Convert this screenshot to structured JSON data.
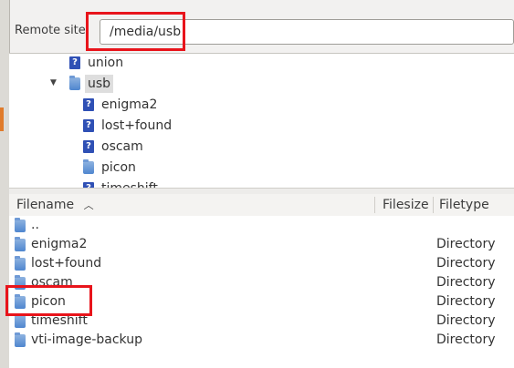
{
  "remote": {
    "label": "Remote site:",
    "path": "/media/usb"
  },
  "tree": {
    "items": [
      {
        "label": "union",
        "icon": "question-icon"
      },
      {
        "label": "usb",
        "icon": "folder-icon",
        "expanded": true,
        "selected": true
      },
      {
        "label": "enigma2",
        "icon": "question-icon"
      },
      {
        "label": "lost+found",
        "icon": "question-icon"
      },
      {
        "label": "oscam",
        "icon": "question-icon"
      },
      {
        "label": "picon",
        "icon": "folder-icon"
      },
      {
        "label": "timeshift",
        "icon": "question-icon"
      }
    ]
  },
  "filelist": {
    "columns": {
      "filename": "Filename",
      "filesize": "Filesize",
      "filetype": "Filetype",
      "sort_icon": "sort-ascending-icon"
    },
    "rows": [
      {
        "name": "..",
        "type": ""
      },
      {
        "name": "enigma2",
        "type": "Directory"
      },
      {
        "name": "lost+found",
        "type": "Directory"
      },
      {
        "name": "oscam",
        "type": "Directory"
      },
      {
        "name": "picon",
        "type": "Directory"
      },
      {
        "name": "timeshift",
        "type": "Directory"
      },
      {
        "name": "vti-image-backup",
        "type": "Directory"
      }
    ]
  },
  "colors": {
    "highlight": "#e8141b",
    "folder": "#4f86cf",
    "question": "#2f50b5"
  }
}
